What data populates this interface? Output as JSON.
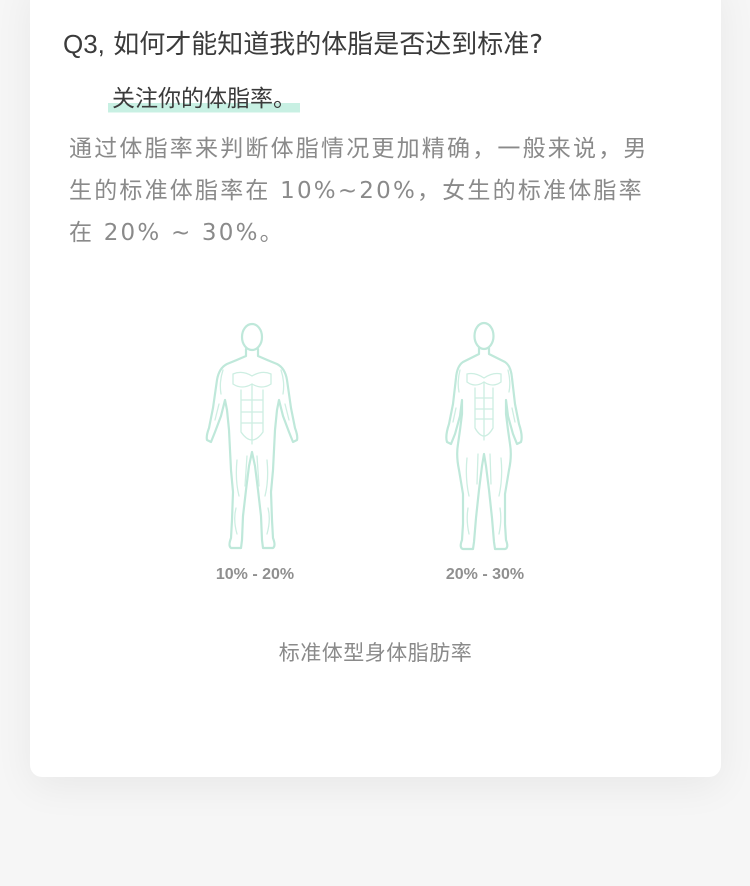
{
  "question": {
    "number": "Q3,",
    "text": "如何才能知道我的体脂是否达到标准?"
  },
  "highlight": "关注你的体脂率。",
  "description": "通过体脂率来判断体脂情况更加精确，一般来说，男生的标准体脂率在 10%~20%，女生的标准体脂率在 20% ~ 30%。",
  "figures": {
    "male": {
      "label": "10% - 20%",
      "icon": "male-body-icon"
    },
    "female": {
      "label": "20% - 30%",
      "icon": "female-body-icon"
    }
  },
  "caption": "标准体型身体脂肪率",
  "colors": {
    "accent_highlight": "#c8f0e3",
    "figure_stroke": "#bfe8da",
    "title_text": "#3b3b3b",
    "body_text": "#8a8a8a"
  }
}
